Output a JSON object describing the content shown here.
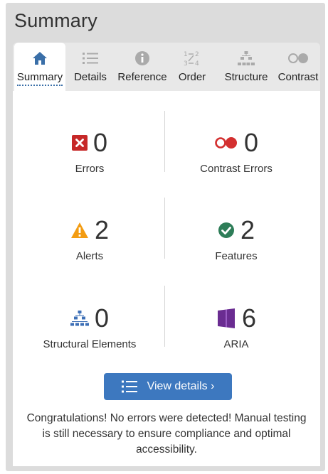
{
  "panel": {
    "title": "Summary"
  },
  "tabs": [
    {
      "label": "Summary",
      "icon": "home-icon",
      "active": true
    },
    {
      "label": "Details",
      "icon": "list-icon",
      "active": false
    },
    {
      "label": "Reference",
      "icon": "info-icon",
      "active": false
    },
    {
      "label": "Order",
      "icon": "order-icon",
      "active": false
    },
    {
      "label": "Structure",
      "icon": "structure-icon",
      "active": false
    },
    {
      "label": "Contrast",
      "icon": "contrast-icon",
      "active": false
    }
  ],
  "stats": [
    {
      "label": "Errors",
      "value": "0",
      "icon": "error-icon",
      "color": "#c62828"
    },
    {
      "label": "Contrast Errors",
      "value": "0",
      "icon": "contrast-error-icon",
      "color": "#d32f2f"
    },
    {
      "label": "Alerts",
      "value": "2",
      "icon": "alert-icon",
      "color": "#f39c12"
    },
    {
      "label": "Features",
      "value": "2",
      "icon": "feature-check-icon",
      "color": "#2e7d58"
    },
    {
      "label": "Structural Elements",
      "value": "0",
      "icon": "structure-element-icon",
      "color": "#3d6fb6"
    },
    {
      "label": "ARIA",
      "value": "6",
      "icon": "aria-icon",
      "color": "#6a2c91"
    }
  ],
  "view_details": {
    "label": "View details ›"
  },
  "message": "Congratulations! No errors were detected! Manual testing is still necessary to ensure compliance and optimal accessibility.",
  "colors": {
    "tab_icon_active": "#3a6fa8",
    "tab_icon_inactive": "#aaaaaa",
    "button": "#3d78bf"
  }
}
